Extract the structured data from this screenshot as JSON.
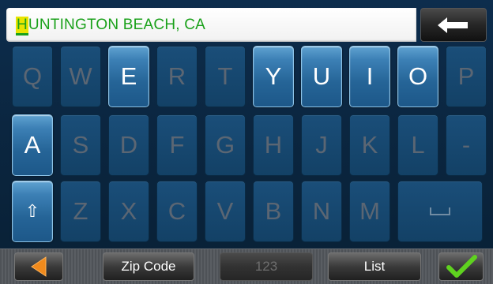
{
  "search": {
    "first_char": "H",
    "rest_text": "UNTINGTON BEACH, CA"
  },
  "keyboard": {
    "row1": [
      "Q",
      "W",
      "E",
      "R",
      "T",
      "Y",
      "U",
      "I",
      "O",
      "P"
    ],
    "row2": [
      "A",
      "S",
      "D",
      "F",
      "G",
      "H",
      "J",
      "K",
      "L",
      "-"
    ],
    "row3": [
      "Z",
      "X",
      "C",
      "V",
      "B",
      "N",
      "M"
    ],
    "enabled_keys": [
      "E",
      "Y",
      "U",
      "I",
      "O",
      "A",
      "shift"
    ],
    "shift_symbol": "⇧"
  },
  "toolbar": {
    "back_icon": "back-arrow-icon",
    "zip_label": "Zip Code",
    "numbers_label": "123",
    "list_label": "List",
    "confirm_icon": "checkmark-icon"
  },
  "colors": {
    "accent_text": "#1aa11a",
    "highlight": "#e8e400",
    "active_key": "#3c80b5",
    "back_arrow": "#f08a1c",
    "check": "#5fd21f"
  }
}
